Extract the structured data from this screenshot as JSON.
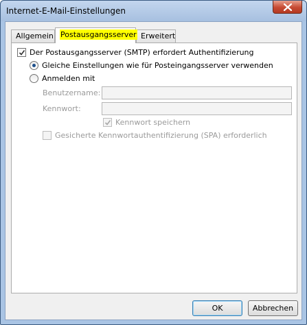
{
  "window": {
    "title": "Internet-E-Mail-Einstellungen"
  },
  "tabs": [
    {
      "label": "Allgemein",
      "active": false
    },
    {
      "label": "Postausgangsserver",
      "active": true
    },
    {
      "label": "Erweitert",
      "active": false
    }
  ],
  "outgoing": {
    "auth_required_label": "Der Postausgangsserver (SMTP) erfordert Authentifizierung",
    "auth_required_checked": true,
    "same_settings_label": "Gleiche Einstellungen wie für Posteingangsserver verwenden",
    "same_settings_selected": true,
    "login_with_label": "Anmelden mit",
    "login_with_selected": false,
    "username_label": "Benutzername:",
    "username_value": "",
    "password_label": "Kennwort:",
    "password_value": "",
    "remember_password_label": "Kennwort speichern",
    "remember_password_checked": true,
    "spa_label": "Gesicherte Kennwortauthentifizierung (SPA) erforderlich",
    "spa_checked": false
  },
  "buttons": {
    "ok": "OK",
    "cancel": "Abbrechen"
  },
  "colors": {
    "tab_highlight": "#ffff00",
    "close_button": "#c64a33",
    "titlebar": "#a7c0e0"
  }
}
